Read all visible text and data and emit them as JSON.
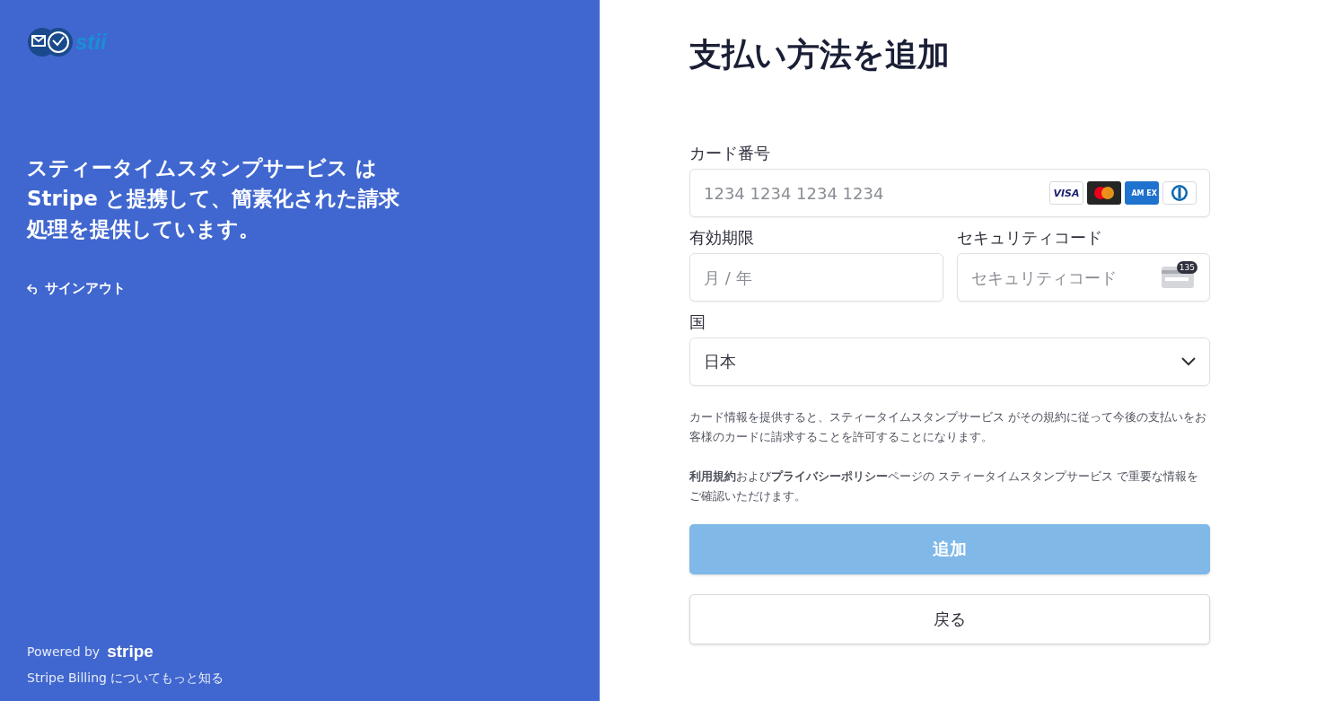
{
  "sidebar": {
    "logo_text": "stii",
    "headline": "スティータイムスタンプサービス は Stripe と提携して、簡素化された請求処理を提供しています。",
    "sign_out": "サインアウト",
    "powered_by": "Powered by",
    "powered_brand": "stripe",
    "learn_more": "Stripe Billing についてもっと知る"
  },
  "form": {
    "title": "支払い方法を追加",
    "card_number": {
      "label": "カード番号",
      "placeholder": "1234 1234 1234 1234",
      "brands": [
        {
          "kind": "visa",
          "text": "VISA"
        },
        {
          "kind": "mastercard"
        },
        {
          "kind": "amex",
          "text": "AM EX"
        },
        {
          "kind": "diners"
        }
      ]
    },
    "expiry": {
      "label": "有効期限",
      "placeholder": "月 / 年"
    },
    "cvc": {
      "label": "セキュリティコード",
      "placeholder": "セキュリティコード",
      "badge": "135"
    },
    "country": {
      "label": "国",
      "value": "日本"
    },
    "consent": "カード情報を提供すると、スティータイムスタンプサービス がその規約に従って今後の支払いをお客様のカードに請求することを許可することになります。",
    "terms": "**利用規約**および**プライバシーポリシー**ページの スティータイムスタンプサービス で重要な情報をご確認いただけます。",
    "submit": {
      "label": "追加",
      "disabled": true
    },
    "back": {
      "label": "戻る"
    }
  }
}
